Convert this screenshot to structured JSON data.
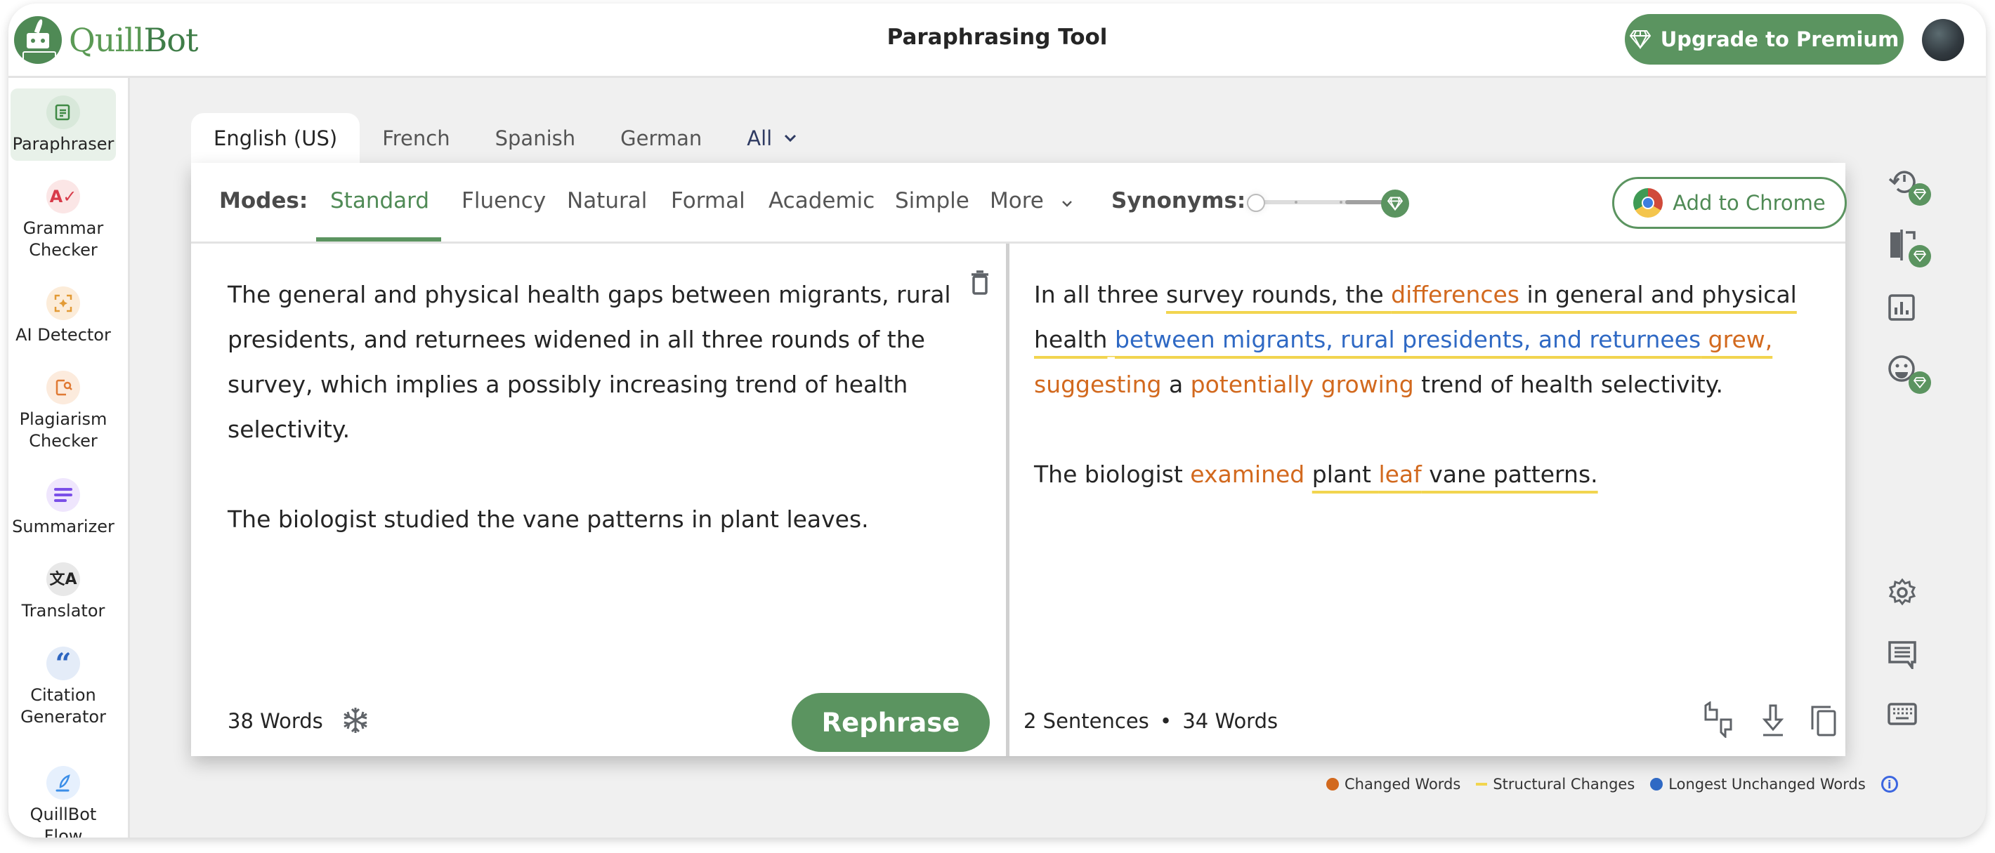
{
  "header": {
    "logo_text_1": "Quill",
    "logo_text_2": "Bot",
    "title": "Paraphrasing Tool",
    "upgrade_label": "Upgrade to Premium"
  },
  "sidebar": {
    "items": [
      {
        "label": "Paraphraser",
        "icon": "paraphraser-icon",
        "active": true
      },
      {
        "label": "Grammar Checker",
        "icon": "grammar-check-icon"
      },
      {
        "label": "AI Detector",
        "icon": "ai-detector-icon"
      },
      {
        "label": "Plagiarism Checker",
        "icon": "plagiarism-icon"
      },
      {
        "label": "Summarizer",
        "icon": "summarizer-icon"
      },
      {
        "label": "Translator",
        "icon": "translate-icon"
      },
      {
        "label": "Citation Generator",
        "icon": "quote-icon"
      },
      {
        "label": "QuillBot Flow",
        "icon": "quill-icon"
      }
    ]
  },
  "languages": {
    "tabs": [
      "English (US)",
      "French",
      "Spanish",
      "German",
      "All"
    ],
    "active": "English (US)"
  },
  "toolbar": {
    "modes_label": "Modes:",
    "modes": [
      "Standard",
      "Fluency",
      "Natural",
      "Formal",
      "Academic",
      "Simple",
      "More"
    ],
    "active_mode": "Standard",
    "synonyms_label": "Synonyms:",
    "synonyms_level": 0,
    "chrome_label": "Add to Chrome"
  },
  "input": {
    "paragraphs": [
      "The general and physical health gaps between migrants, rural presidents, and returnees widened in all three rounds of the survey, which implies a possibly increasing trend of health selectivity.",
      "The biologist studied the vane patterns in plant leaves."
    ],
    "word_count": "38 Words",
    "rephrase_label": "Rephrase"
  },
  "output": {
    "p1": {
      "a": "In all three ",
      "b": "survey rounds, the ",
      "c": "differences",
      "d": " in general and physical health",
      "e": "between migrants, rural presidents, and returnees",
      "f": " grew,",
      "g": " suggesting",
      "h": " a ",
      "i": "potentially growing",
      "j": " trend of health selectivity."
    },
    "p2": {
      "a": "The biologist ",
      "b": "examined",
      "c": " ",
      "d": "plant ",
      "e": "leaf",
      "f": " vane patterns."
    },
    "sentence_count": "2 Sentences",
    "word_count": "34 Words",
    "separator": "•"
  },
  "legend": {
    "changed": "Changed Words",
    "structural": "Structural Changes",
    "unchanged": "Longest Unchanged Words",
    "colors": {
      "changed": "#d2691e",
      "structural": "#f2d54f",
      "unchanged": "#2f69c4"
    }
  },
  "colors": {
    "brand": "#5b9460"
  }
}
